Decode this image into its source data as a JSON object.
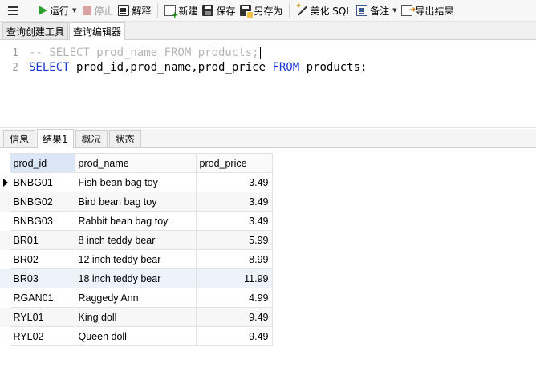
{
  "toolbar": {
    "run": "运行",
    "stop": "停止",
    "explain": "解释",
    "new": "新建",
    "save": "保存",
    "save_as": "另存为",
    "beautify": "美化 SQL",
    "note": "备注",
    "export": "导出结果"
  },
  "editor_tabs": [
    "查询创建工具",
    "查询编辑器"
  ],
  "editor": {
    "line1_number": "1",
    "line1_comment": "-- SELECT prod_name FROM products;",
    "line2_number": "2",
    "line2_kw_select": "SELECT",
    "line2_columns": " prod_id,prod_name,prod_price ",
    "line2_kw_from": "FROM",
    "line2_table": " products;"
  },
  "result_tabs": [
    "信息",
    "结果1",
    "概况",
    "状态"
  ],
  "grid": {
    "columns": [
      "prod_id",
      "prod_name",
      "prod_price"
    ],
    "rows": [
      [
        "BNBG01",
        "Fish bean bag toy",
        "3.49"
      ],
      [
        "BNBG02",
        "Bird bean bag toy",
        "3.49"
      ],
      [
        "BNBG03",
        "Rabbit bean bag toy",
        "3.49"
      ],
      [
        "BR01",
        "8 inch teddy bear",
        "5.99"
      ],
      [
        "BR02",
        "12 inch teddy bear",
        "8.99"
      ],
      [
        "BR03",
        "18 inch teddy bear",
        "11.99"
      ],
      [
        "RGAN01",
        "Raggedy Ann",
        "4.99"
      ],
      [
        "RYL01",
        "King doll",
        "9.49"
      ],
      [
        "RYL02",
        "Queen doll",
        "9.49"
      ]
    ]
  },
  "colors": {
    "run_icon": "#2ca02c",
    "keyword": "#1a36d6",
    "comment": "#b5b5b5",
    "selected_header": "#dbe7f7"
  }
}
